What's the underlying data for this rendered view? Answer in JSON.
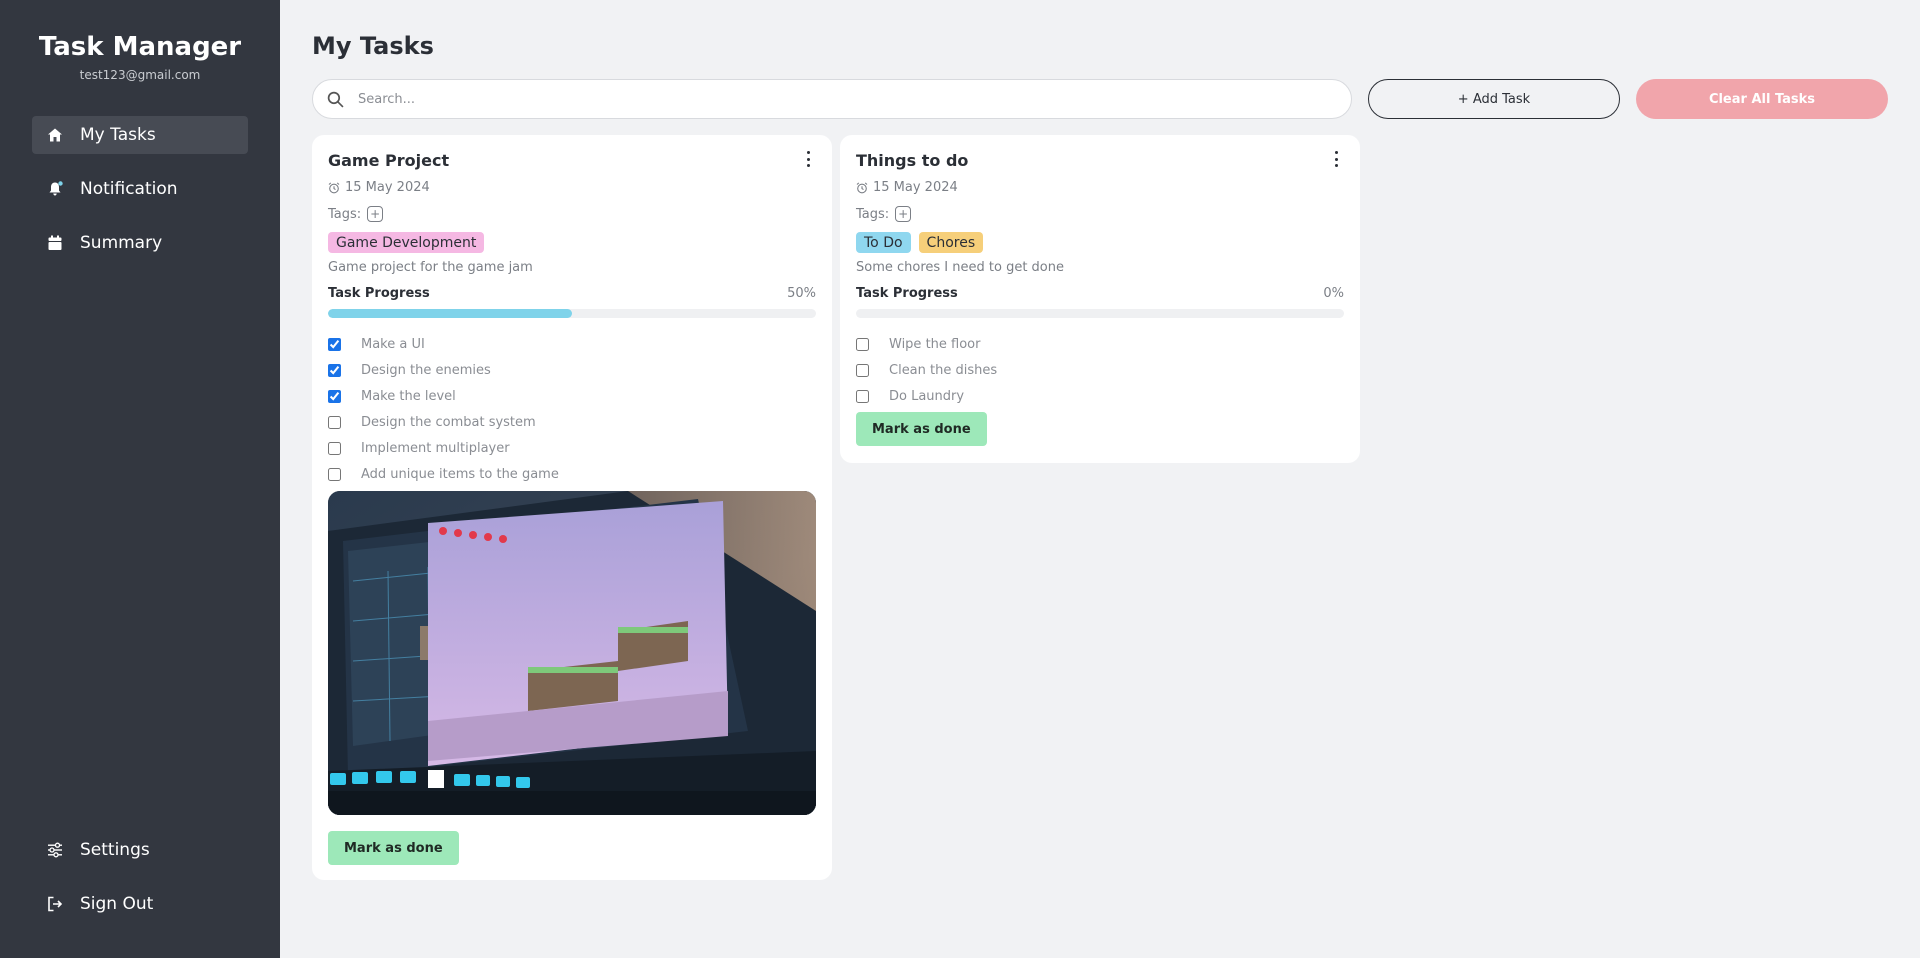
{
  "sidebar": {
    "app_title": "Task Manager",
    "email": "test123@gmail.com",
    "nav": [
      {
        "label": "My Tasks",
        "icon": "home-icon"
      },
      {
        "label": "Notification",
        "icon": "bell-icon"
      },
      {
        "label": "Summary",
        "icon": "calendar-icon"
      }
    ],
    "bottom_nav": [
      {
        "label": "Settings",
        "icon": "sliders-icon"
      },
      {
        "label": "Sign Out",
        "icon": "sign-out-icon"
      }
    ]
  },
  "main": {
    "title": "My Tasks",
    "search_placeholder": "Search...",
    "add_task_label": "+ Add Task",
    "clear_all_label": "Clear All Tasks"
  },
  "cards": [
    {
      "title": "Game Project",
      "date": "15 May 2024",
      "tags_label": "Tags:",
      "tags": [
        {
          "label": "Game Development",
          "color": "#f5b8e3"
        }
      ],
      "description": "Game project for the game jam",
      "progress_label": "Task Progress",
      "progress_text": "50%",
      "progress_value": 0.5,
      "items": [
        {
          "label": "Make a UI",
          "checked": true
        },
        {
          "label": "Design the enemies",
          "checked": true
        },
        {
          "label": "Make the level",
          "checked": true
        },
        {
          "label": "Design the combat system",
          "checked": false
        },
        {
          "label": "Implement multiplayer",
          "checked": false
        },
        {
          "label": "Add unique items to the game",
          "checked": false
        }
      ],
      "done_label": "Mark as done"
    },
    {
      "title": "Things to do",
      "date": "15 May 2024",
      "tags_label": "Tags:",
      "tags": [
        {
          "label": "To Do",
          "color": "#8fd7ef"
        },
        {
          "label": "Chores",
          "color": "#f6cf7a"
        }
      ],
      "description": "Some chores I need to get done",
      "progress_label": "Task Progress",
      "progress_text": "0%",
      "progress_value": 0,
      "items": [
        {
          "label": "Wipe the floor",
          "checked": false
        },
        {
          "label": "Clean the dishes",
          "checked": false
        },
        {
          "label": "Do Laundry",
          "checked": false
        }
      ],
      "done_label": "Mark as done"
    }
  ]
}
